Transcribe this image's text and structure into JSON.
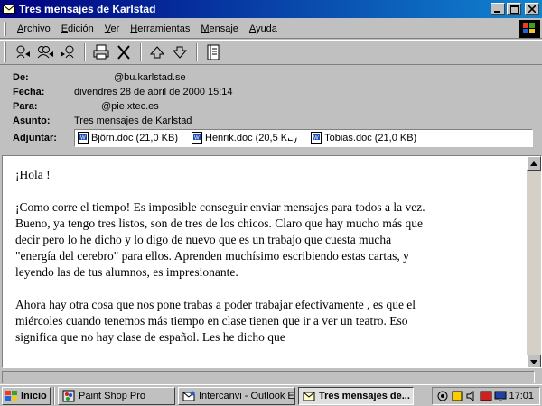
{
  "window": {
    "title": "Tres mensajes de Karlstad",
    "minimize_label": "_",
    "maximize_label": "□",
    "close_label": "×"
  },
  "menu": {
    "items": [
      "Archivo",
      "Edición",
      "Ver",
      "Herramientas",
      "Mensaje",
      "Ayuda"
    ],
    "underline": [
      "A",
      "E",
      "V",
      "H",
      "M",
      "A"
    ]
  },
  "toolbar": {
    "icons": [
      "reply-icon",
      "reply-all-icon",
      "forward-icon",
      "print-icon",
      "delete-icon",
      "previous-icon",
      "next-icon",
      "address-book-icon"
    ]
  },
  "header": {
    "from_label": "De:",
    "from_value": "@bu.karlstad.se",
    "date_label": "Fecha:",
    "date_value": "divendres 28 de abril de 2000 15:14",
    "to_label": "Para:",
    "to_value": "@pie.xtec.es",
    "subject_label": "Asunto:",
    "subject_value": "Tres mensajes de Karlstad",
    "attach_label": "Adjuntar:",
    "attachments": [
      "Björn.doc (21,0 KB)",
      "Henrik.doc (20,5 KB)",
      "Tobias.doc (21,0 KB)"
    ]
  },
  "body": {
    "greeting": "¡Hola !",
    "paragraph1": "¡Como corre el tiempo! Es imposible conseguir enviar mensajes para todos a la vez. Bueno, ya tengo tres listos, son de tres de los chicos. Claro que hay mucho más que decir pero lo he dicho y lo digo de nuevo que es un trabajo que cuesta mucha \"energía del cerebro\" para ellos. Aprenden muchísimo escribiendo estas cartas, y leyendo las de tus alumnos, es impresionante.",
    "paragraph2": "Ahora hay otra cosa que nos pone trabas a poder trabajar efectivamente , es que el miércoles cuando tenemos más tiempo en clase tienen que ir a ver un teatro. Eso significa que no hay clase de español. Les he dicho que"
  },
  "taskbar": {
    "start_label": "Inicio",
    "tasks": [
      "Paint Shop Pro",
      "Intercanvi - Outlook E...",
      "Tres mensajes de..."
    ],
    "active_task_index": 2,
    "clock": "17:01"
  },
  "colors": {
    "title_gradient_start": "#000080",
    "title_gradient_end": "#1084d0",
    "face": "#c0c0c0"
  }
}
